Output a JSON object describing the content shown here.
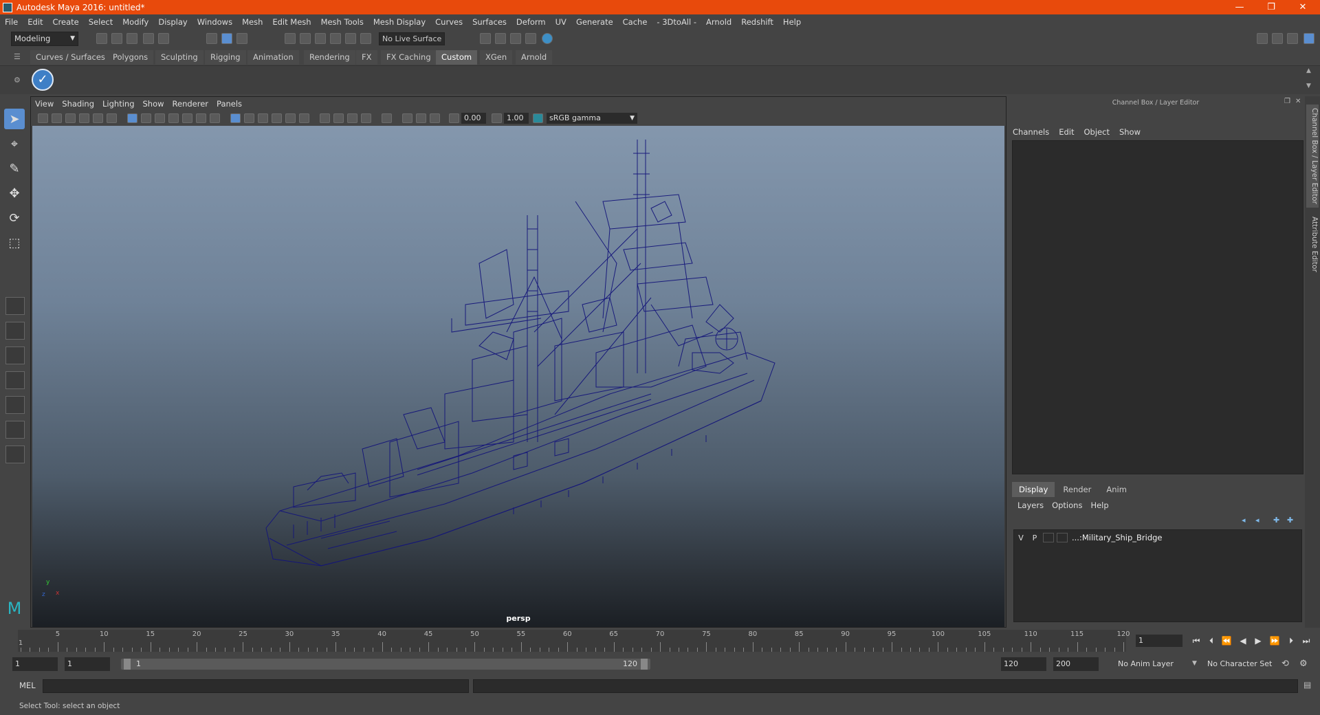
{
  "window": {
    "title": "Autodesk Maya 2016: untitled*",
    "minimize": "—",
    "restore": "❐",
    "close": "✕"
  },
  "menubar": [
    "File",
    "Edit",
    "Create",
    "Select",
    "Modify",
    "Display",
    "Windows",
    "Mesh",
    "Edit Mesh",
    "Mesh Tools",
    "Mesh Display",
    "Curves",
    "Surfaces",
    "Deform",
    "UV",
    "Generate",
    "Cache",
    "- 3DtoAll -",
    "Arnold",
    "Redshift",
    "Help"
  ],
  "statusline": {
    "mode": "Modeling",
    "live_surface": "No Live Surface"
  },
  "shelf_tabs": [
    "Curves / Surfaces",
    "Polygons",
    "Sculpting",
    "Rigging",
    "Animation",
    "Rendering",
    "FX",
    "FX Caching",
    "Custom",
    "XGen",
    "Arnold"
  ],
  "shelf_active_tab": "Custom",
  "viewport": {
    "menu": [
      "View",
      "Shading",
      "Lighting",
      "Show",
      "Renderer",
      "Panels"
    ],
    "exposure": "0.00",
    "gamma": "1.00",
    "color_space": "sRGB gamma",
    "camera": "persp",
    "axis_y": "y",
    "axis_x": "x",
    "axis_z": "z"
  },
  "channel_box": {
    "title": "Channel Box / Layer Editor",
    "menu": [
      "Channels",
      "Edit",
      "Object",
      "Show"
    ]
  },
  "layer_editor": {
    "tabs": [
      "Display",
      "Render",
      "Anim"
    ],
    "active_tab": "Display",
    "menu": [
      "Layers",
      "Options",
      "Help"
    ],
    "layers": [
      {
        "v": "V",
        "p": "P",
        "name": "...:Military_Ship_Bridge"
      }
    ]
  },
  "side_tabs": [
    "Channel Box / Layer Editor",
    "Attribute Editor"
  ],
  "timeline": {
    "ticks": [
      5,
      10,
      15,
      20,
      25,
      30,
      35,
      40,
      45,
      50,
      55,
      60,
      65,
      70,
      75,
      80,
      85,
      90,
      95,
      100,
      105,
      110,
      115,
      120
    ],
    "start_label": "1",
    "current_frame": "1"
  },
  "range": {
    "start": "1",
    "playback_start": "1",
    "bar_start": "1",
    "bar_end": "120",
    "playback_end": "120",
    "end": "200",
    "anim_layer": "No Anim Layer",
    "character_set": "No Character Set"
  },
  "cmdline": {
    "label": "MEL"
  },
  "helpline": "Select Tool: select an object"
}
